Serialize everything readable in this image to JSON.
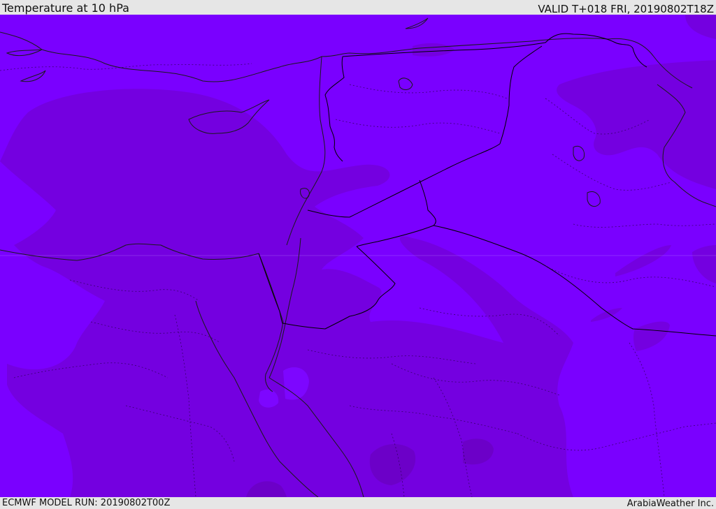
{
  "header": {
    "title": "Temperature at 10 hPa",
    "valid": "VALID T+018 FRI, 20190802T18Z"
  },
  "footer": {
    "model_run": "ECMWF MODEL RUN: 20190802T00Z",
    "credit": "ArabiaWeather Inc."
  },
  "map": {
    "fill_colors": {
      "base": "#7a00ff",
      "darker": "#7400e0",
      "darkest": "#6c00c8",
      "grid": "#b58cff"
    }
  }
}
